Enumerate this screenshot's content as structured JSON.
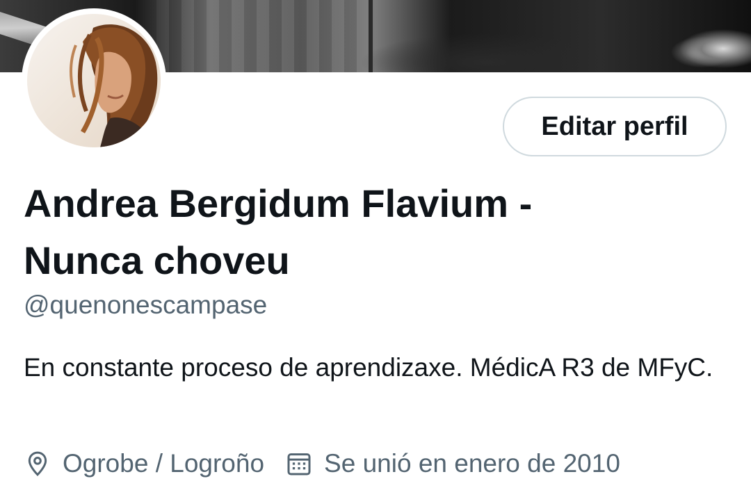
{
  "profile": {
    "display_name": "Andrea Bergidum Flavium - Nunca choveu",
    "handle": "@quenonescampase",
    "bio": "En constante proceso de aprendizaxe. MédicA R3 de MFyC.",
    "location": "Ogrobe / Logroño",
    "joined": "Se unió en enero de 2010"
  },
  "actions": {
    "edit_profile_label": "Editar perfil"
  },
  "icons": {
    "location": "location-pin-icon",
    "joined": "calendar-icon"
  },
  "colors": {
    "text_primary": "#0f1419",
    "text_secondary": "#536471",
    "button_border": "#cfd9de"
  }
}
